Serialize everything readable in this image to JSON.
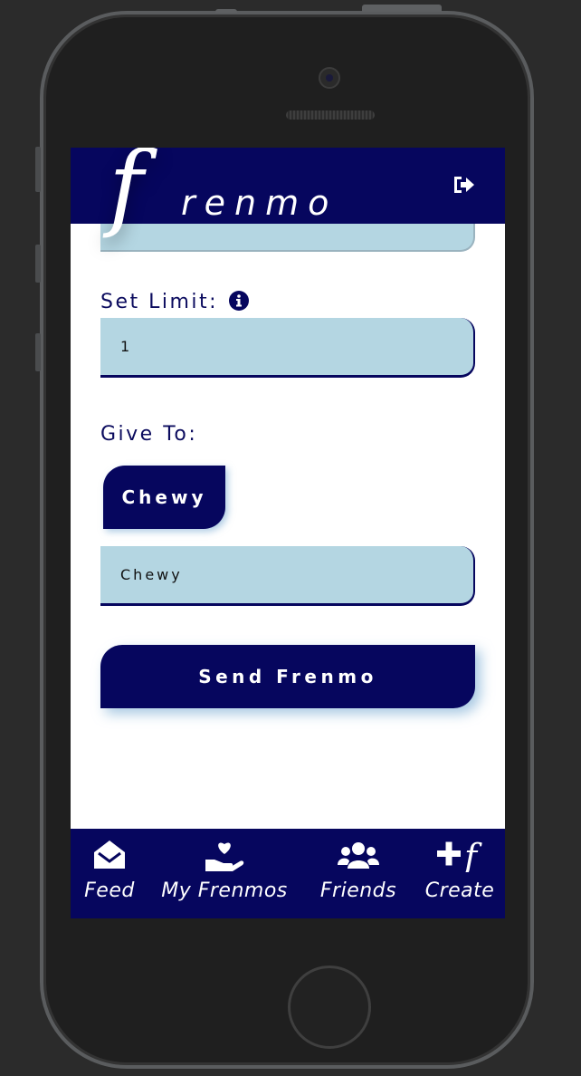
{
  "header": {
    "logo_f": "f",
    "logo_rest": "renmo",
    "logout_icon": "sign-out-icon"
  },
  "form": {
    "partial_field_text": "",
    "limit_label": "Set Limit:",
    "info_icon": "info-circle-icon",
    "limit_value": "1",
    "give_to_label": "Give To:",
    "selected_friend": "Chewy",
    "friend_input_value": "Chewy",
    "send_button": "Send Frenmo"
  },
  "tabs": [
    {
      "label": "Feed",
      "icon": "envelope-open-icon"
    },
    {
      "label": "My Frenmos",
      "icon": "hand-holding-heart-icon"
    },
    {
      "label": "Friends",
      "icon": "users-icon"
    },
    {
      "label": "Create",
      "icon": "plus-f-icon"
    }
  ],
  "colors": {
    "primary": "#06065e",
    "input_bg": "#b4d6e2",
    "surface": "#ffffff",
    "device_bg": "#2b2b2b"
  }
}
